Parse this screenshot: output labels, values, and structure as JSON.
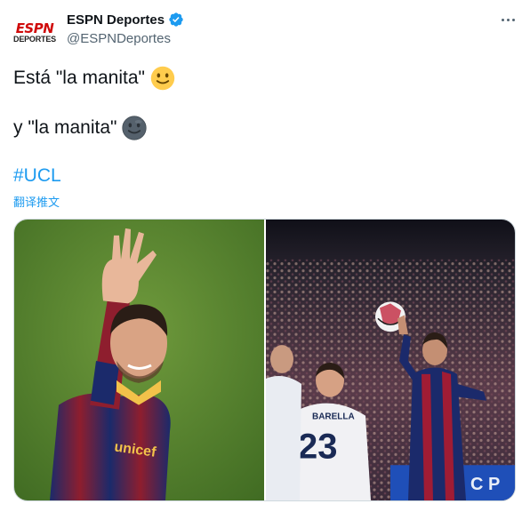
{
  "author": {
    "display_name": "ESPN Deportes",
    "handle": "@ESPNDeportes",
    "logo_top": "ESPN",
    "logo_bottom": "DEPORTES",
    "verified_icon": "verified-badge-icon"
  },
  "tweet": {
    "line1": "Está \"la manita\"",
    "line1_emoji": "slightly-smiling-face-icon",
    "line2": "y \"la manita\"",
    "line2_emoji": "new-moon-face-icon",
    "hashtag": "#UCL",
    "translate_label": "翻译推文"
  },
  "media": {
    "images": [
      {
        "name": "photo-pique-waving",
        "jersey_text": "unicef"
      },
      {
        "name": "photo-pique-handball",
        "player_name": "BARELLA",
        "player_number": "23"
      }
    ]
  },
  "colors": {
    "link": "#1d9bf0",
    "text": "#0f1419",
    "secondary": "#536471",
    "brand_red": "#d00a0a"
  }
}
